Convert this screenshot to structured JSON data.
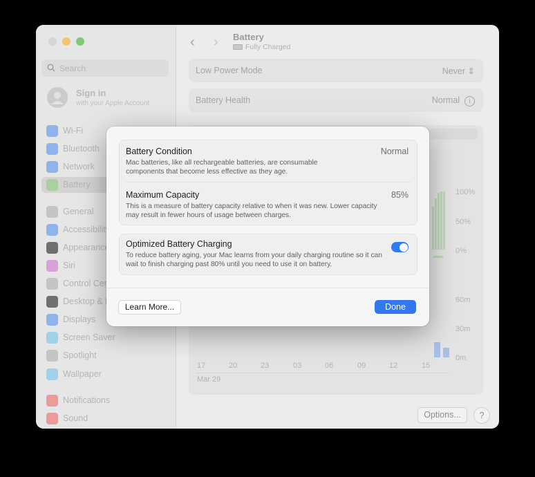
{
  "sidebar": {
    "search_placeholder": "Search",
    "account": {
      "title": "Sign in",
      "subtitle": "with your Apple Account"
    },
    "items": [
      {
        "label": "Wi-Fi",
        "icon": "wifi-icon",
        "color": "#8fb4ea"
      },
      {
        "label": "Bluetooth",
        "icon": "bluetooth-icon",
        "color": "#8fb4ea"
      },
      {
        "label": "Network",
        "icon": "globe-icon",
        "color": "#8fb4ea"
      },
      {
        "label": "Battery",
        "icon": "battery-icon",
        "color": "#a9d19c"
      },
      {
        "label": "General",
        "icon": "gear-icon",
        "color": "#c4c4c4"
      },
      {
        "label": "Accessibility",
        "icon": "accessibility-icon",
        "color": "#8fb4ea"
      },
      {
        "label": "Appearance",
        "icon": "appearance-icon",
        "color": "#707070"
      },
      {
        "label": "Siri",
        "icon": "siri-icon",
        "color": "#d7a1d6"
      },
      {
        "label": "Control Center",
        "icon": "control-center-icon",
        "color": "#c4c4c4"
      },
      {
        "label": "Desktop & Dock",
        "icon": "dock-icon",
        "color": "#707070"
      },
      {
        "label": "Displays",
        "icon": "displays-icon",
        "color": "#8fb4ea"
      },
      {
        "label": "Screen Saver",
        "icon": "screen-saver-icon",
        "color": "#9fd2e8"
      },
      {
        "label": "Spotlight",
        "icon": "spotlight-icon",
        "color": "#c4c4c4"
      },
      {
        "label": "Wallpaper",
        "icon": "wallpaper-icon",
        "color": "#9fd2e8"
      },
      {
        "label": "Notifications",
        "icon": "notifications-icon",
        "color": "#ec9a9a"
      },
      {
        "label": "Sound",
        "icon": "sound-icon",
        "color": "#ec9a9a"
      }
    ],
    "selected": "Battery"
  },
  "main": {
    "title": "Battery",
    "subtitle": "Fully Charged",
    "low_power": {
      "label": "Low Power Mode",
      "value": "Never"
    },
    "health": {
      "label": "Battery Health",
      "value": "Normal"
    },
    "chart": {
      "level_labels": [
        "100%",
        "50%",
        "0%"
      ],
      "usage_labels": [
        "60m",
        "30m",
        "0m"
      ],
      "time_labels": [
        "17",
        "20",
        "23",
        "03",
        "06",
        "09",
        "12",
        "15"
      ],
      "date_label": "Mar 29"
    },
    "options_label": "Options...",
    "help_label": "?"
  },
  "sheet": {
    "battery_condition": {
      "title": "Battery Condition",
      "value": "Normal",
      "desc": "Mac batteries, like all rechargeable batteries, are consumable components that become less effective as they age."
    },
    "maximum_capacity": {
      "title": "Maximum Capacity",
      "value": "85%",
      "desc": "This is a measure of battery capacity relative to when it was new. Lower capacity may result in fewer hours of usage between charges."
    },
    "optimized_charging": {
      "title": "Optimized Battery Charging",
      "enabled": true,
      "desc": "To reduce battery aging, your Mac learns from your daily charging routine so it can wait to finish charging past 80% until you need to use it on battery."
    },
    "learn_more_label": "Learn More...",
    "done_label": "Done"
  },
  "colors": {
    "accent": "#3478f0",
    "toggle_on": "#2f7bf5"
  }
}
